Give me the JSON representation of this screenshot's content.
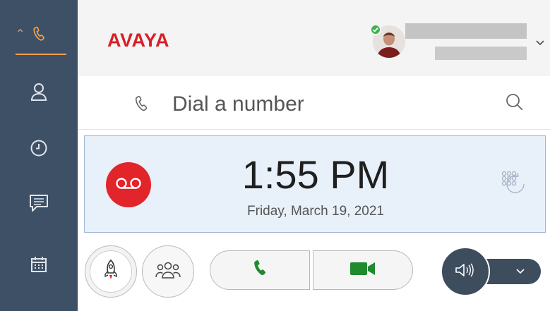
{
  "app": {
    "logo_text": "AVAYA"
  },
  "sidebar": {
    "items": [
      {
        "id": "phone",
        "icon": "phone-icon",
        "active": true
      },
      {
        "id": "contacts",
        "icon": "person-icon"
      },
      {
        "id": "history",
        "icon": "clock-icon"
      },
      {
        "id": "messages",
        "icon": "chat-icon"
      },
      {
        "id": "calendar",
        "icon": "calendar-icon"
      }
    ]
  },
  "dial": {
    "placeholder": "Dial a number"
  },
  "clock": {
    "time": "1:55 PM",
    "date": "Friday, March 19, 2021"
  },
  "user": {
    "presence": "available"
  },
  "colors": {
    "brand": "#d81f26",
    "sidebar": "#3d5066",
    "accent": "#f0a04b",
    "presence": "#3bb54a",
    "call_green": "#1f8a2e",
    "voicemail_red": "#e2242b"
  }
}
